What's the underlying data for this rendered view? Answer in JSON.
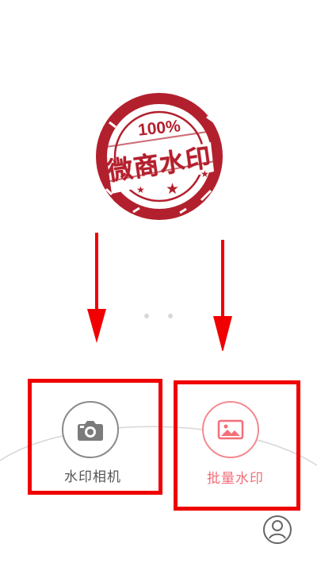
{
  "brand": {
    "stamp_top_text": "100%",
    "stamp_main_text": "微商水印",
    "stamp_color": "#b3202d"
  },
  "pager": {
    "total_pages": 2,
    "dot_color": "#d8d8d8"
  },
  "actions": {
    "watermark_camera": {
      "label": "水印相机",
      "icon": "camera-icon",
      "color": "#555555"
    },
    "batch_watermark": {
      "label": "批量水印",
      "icon": "image-icon",
      "color": "#f16e78"
    }
  },
  "profile": {
    "icon": "user-icon"
  },
  "annotations": {
    "highlight_color": "#f00000"
  }
}
